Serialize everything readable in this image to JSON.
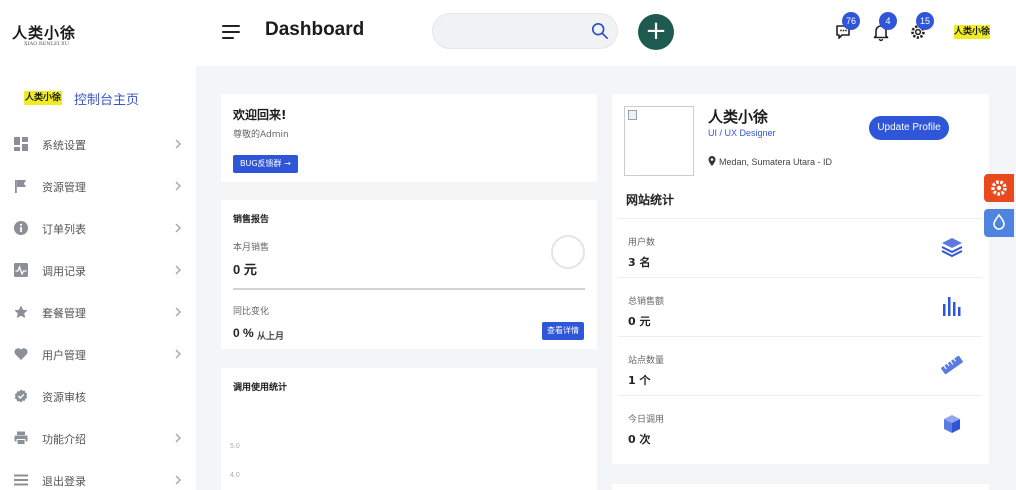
{
  "topbar": {
    "logo_text": "人类小徐",
    "logo_subtext": "XIAO RENLEI XU",
    "title": "Dashboard",
    "search_placeholder": "",
    "add_label": "+",
    "notifications": [
      {
        "name": "messages",
        "count": "76",
        "icon": "chat-icon"
      },
      {
        "name": "alerts",
        "count": "4",
        "icon": "bell-icon"
      },
      {
        "name": "settings",
        "count": "15",
        "icon": "gear-icon"
      }
    ],
    "avatar_text": "人类小徐"
  },
  "sidebar": {
    "brand_logo": "人类小徐",
    "brand_label": "控制台主页",
    "items": [
      {
        "label": "系统设置",
        "icon": "dashboard-grid-icon",
        "has_chevron": true
      },
      {
        "label": "资源管理",
        "icon": "flag-icon",
        "has_chevron": true
      },
      {
        "label": "订单列表",
        "icon": "info-icon",
        "has_chevron": true
      },
      {
        "label": "调用记录",
        "icon": "activity-icon",
        "has_chevron": true
      },
      {
        "label": "套餐管理",
        "icon": "star-icon",
        "has_chevron": true
      },
      {
        "label": "用户管理",
        "icon": "heart-icon",
        "has_chevron": true
      },
      {
        "label": "资源审核",
        "icon": "verified-icon",
        "has_chevron": false
      },
      {
        "label": "功能介绍",
        "icon": "printer-icon",
        "has_chevron": true
      },
      {
        "label": "退出登录",
        "icon": "menu-icon",
        "has_chevron": true
      }
    ]
  },
  "welcome": {
    "title": "欢迎回来!",
    "subtitle": "尊敬的Admin",
    "button_label": "BUG反馈群 →"
  },
  "sales_report": {
    "title": "销售报告",
    "monthly_label": "本月销售",
    "monthly_value": "0 元",
    "change_label": "同比变化",
    "change_value": "0 %",
    "change_suffix": "从上月",
    "detail_button": "查看详情"
  },
  "usage": {
    "title": "调用使用统计",
    "ticks": [
      "5.0",
      "4.0"
    ]
  },
  "profile": {
    "name": "人类小徐",
    "role": "UI / UX Designer",
    "update_button": "Update Profile",
    "location": "Medan, Sumatera Utara - ID"
  },
  "site_stats": {
    "title": "网站统计",
    "rows": [
      {
        "label": "用户数",
        "value": "3 名",
        "icon": "layers-icon"
      },
      {
        "label": "总销售额",
        "value": "0 元",
        "icon": "bar-chart-icon"
      },
      {
        "label": "站点数量",
        "value": "1 个",
        "icon": "ruler-icon"
      },
      {
        "label": "今日调用",
        "value": "0 次",
        "icon": "cube-icon"
      }
    ]
  },
  "floating": {
    "settings_icon": "gear-icon",
    "theme_icon": "droplet-icon"
  },
  "colors": {
    "accent": "#2f56d8",
    "add_button": "#1e5a4f",
    "float_settings": "#e8491d",
    "float_theme": "#4f83e0",
    "avatar_bg": "#f0ec24"
  }
}
